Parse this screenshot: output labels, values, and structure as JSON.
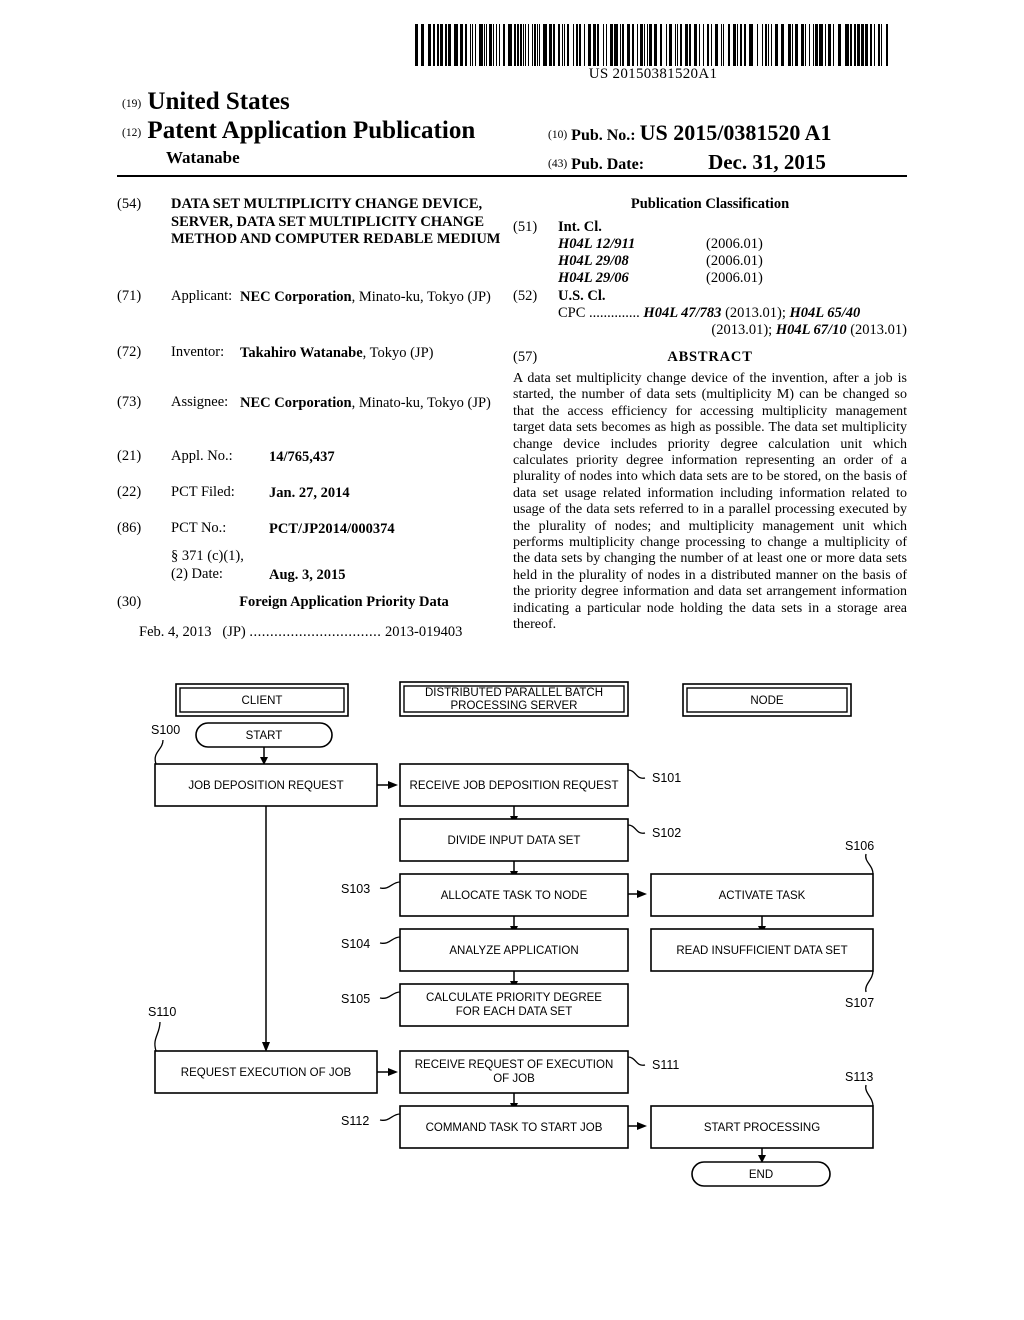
{
  "header": {
    "barcode_number": "US 20150381520A1",
    "country_code": "(19)",
    "country": "United States",
    "doc_type_code": "(12)",
    "doc_type": "Patent Application Publication",
    "author": "Watanabe",
    "pubno_code": "(10)",
    "pubno_label": "Pub. No.:",
    "pubno_value": "US 2015/0381520 A1",
    "pubdate_code": "(43)",
    "pubdate_label": "Pub. Date:",
    "pubdate_value": "Dec. 31, 2015"
  },
  "bibliographic": {
    "title_code": "(54)",
    "title": "DATA SET MULTIPLICITY CHANGE DEVICE, SERVER, DATA SET MULTIPLICITY CHANGE METHOD AND COMPUTER REDABLE MEDIUM",
    "applicant_code": "(71)",
    "applicant_label": "Applicant:",
    "applicant_name": "NEC Corporation",
    "applicant_rest": ", Minato-ku, Tokyo (JP)",
    "inventor_code": "(72)",
    "inventor_label": "Inventor:",
    "inventor_name": "Takahiro Watanabe",
    "inventor_rest": ", Tokyo (JP)",
    "assignee_code": "(73)",
    "assignee_label": "Assignee:",
    "assignee_name": "NEC Corporation",
    "assignee_rest": ", Minato-ku, Tokyo (JP)",
    "applno_code": "(21)",
    "applno_label": "Appl. No.:",
    "applno_value": "14/765,437",
    "pctfiled_code": "(22)",
    "pctfiled_label": "PCT Filed:",
    "pctfiled_value": "Jan. 27, 2014",
    "pctno_code": "(86)",
    "pctno_label": "PCT No.:",
    "pctno_value": "PCT/JP2014/000374",
    "sec371_label": "§ 371 (c)(1),",
    "date2_label": "(2) Date:",
    "date2_value": "Aug. 3, 2015",
    "foreign_code": "(30)",
    "foreign_heading": "Foreign Application Priority Data",
    "foreign_date": "Feb. 4, 2013",
    "foreign_country": "(JP)",
    "foreign_dots": "................................",
    "foreign_number": "2013-019403"
  },
  "classification": {
    "heading": "Publication Classification",
    "intcl_code": "(51)",
    "intcl_label": "Int. Cl.",
    "intcl_entries": [
      {
        "symbol": "H04L 12/911",
        "version": "(2006.01)"
      },
      {
        "symbol": "H04L 29/08",
        "version": "(2006.01)"
      },
      {
        "symbol": "H04L 29/06",
        "version": "(2006.01)"
      }
    ],
    "uscl_code": "(52)",
    "uscl_label": "U.S. Cl.",
    "cpc_prefix": "CPC ..............",
    "cpc_line1_a": "H04L 47/783",
    "cpc_line1_b": " (2013.01); ",
    "cpc_line1_c": "H04L 65/40",
    "cpc_line2_a": "(2013.01); ",
    "cpc_line2_b": "H04L 67/10",
    "cpc_line2_c": " (2013.01)"
  },
  "abstract": {
    "code": "(57)",
    "heading": "ABSTRACT",
    "text": "A data set multiplicity change device of the invention, after a job is started, the number of data sets (multiplicity M) can be changed so that the access efficiency for accessing multiplicity management target data sets becomes as high as possible. The data set multiplicity change device includes priority degree calculation unit which calculates priority degree information representing an order of a plurality of nodes into which data sets are to be stored, on the basis of data set usage related information including information related to usage of the data sets referred to in a parallel processing executed by the plurality of nodes; and multiplicity management unit which performs multiplicity change processing to change a multiplicity of the data sets by changing the number of at least one or more data sets held in the plurality of nodes in a distributed manner on the basis of the priority degree information and data set arrangement information indicating a particular node holding the data sets in a storage area thereof."
  },
  "flowchart": {
    "headers": [
      {
        "id": "client",
        "label": "CLIENT"
      },
      {
        "id": "server",
        "label": "DISTRIBUTED PARALLEL BATCH PROCESSING SERVER"
      },
      {
        "id": "node",
        "label": "NODE"
      }
    ],
    "terminals": [
      {
        "id": "start",
        "label": "START"
      },
      {
        "id": "end",
        "label": "END"
      }
    ],
    "steps": [
      {
        "id": "s100",
        "step": "S100",
        "label": "JOB DEPOSITION REQUEST",
        "lane": "client"
      },
      {
        "id": "s101",
        "step": "S101",
        "label": "RECEIVE JOB DEPOSITION REQUEST",
        "lane": "server"
      },
      {
        "id": "s102",
        "step": "S102",
        "label": "DIVIDE INPUT DATA SET",
        "lane": "server"
      },
      {
        "id": "s103",
        "step": "S103",
        "label": "ALLOCATE TASK TO NODE",
        "lane": "server"
      },
      {
        "id": "s104",
        "step": "S104",
        "label": "ANALYZE APPLICATION",
        "lane": "server"
      },
      {
        "id": "s105",
        "step": "S105",
        "label": "CALCULATE PRIORITY DEGREE FOR EACH DATA SET",
        "lane": "server"
      },
      {
        "id": "s106",
        "step": "S106",
        "label": "ACTIVATE TASK",
        "lane": "node"
      },
      {
        "id": "s107",
        "step": "S107",
        "label": "READ INSUFFICIENT DATA SET",
        "lane": "node"
      },
      {
        "id": "s110",
        "step": "S110",
        "label": "REQUEST EXECUTION OF JOB",
        "lane": "client"
      },
      {
        "id": "s111",
        "step": "S111",
        "label": "RECEIVE REQUEST OF EXECUTION OF JOB",
        "lane": "server"
      },
      {
        "id": "s112",
        "step": "S112",
        "label": "COMMAND TASK TO START JOB",
        "lane": "server"
      },
      {
        "id": "s113",
        "step": "S113",
        "label": "START PROCESSING",
        "lane": "node"
      }
    ]
  }
}
